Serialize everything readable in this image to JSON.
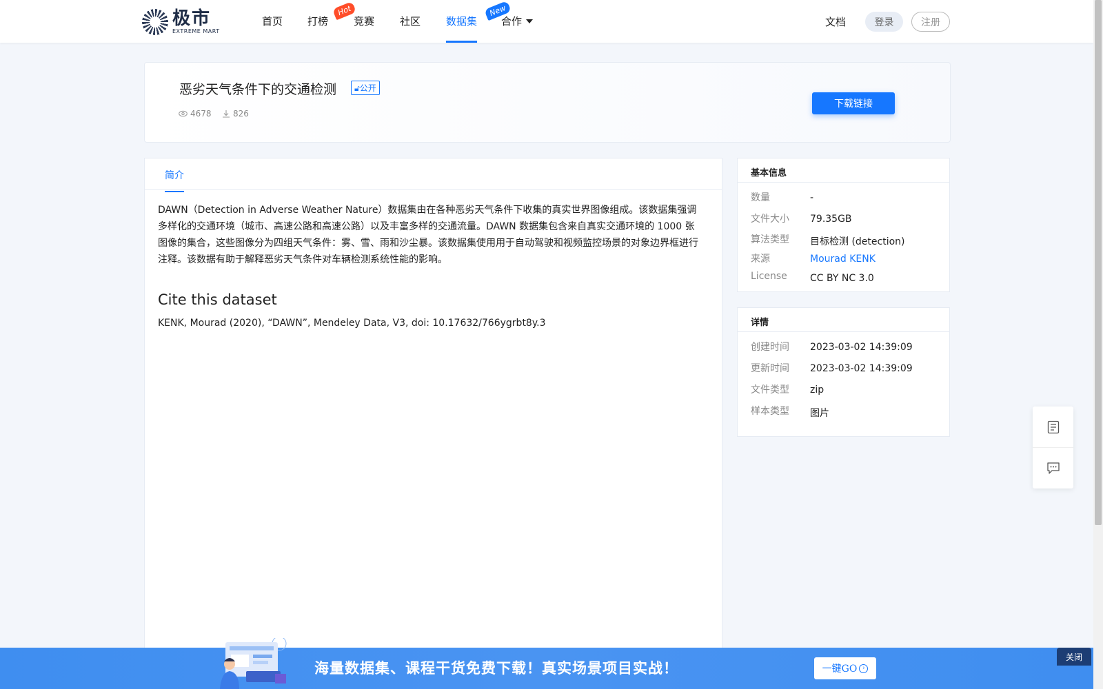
{
  "nav": {
    "logo_cn": "极市",
    "logo_en": "EXTREME MART",
    "items": [
      {
        "label": "首页"
      },
      {
        "label": "打榜",
        "badge": "Hot"
      },
      {
        "label": "竞赛"
      },
      {
        "label": "社区"
      },
      {
        "label": "数据集",
        "badge": "New",
        "active": true
      },
      {
        "label": "合作"
      }
    ],
    "docs": "文档",
    "login": "登录",
    "register": "注册"
  },
  "dataset": {
    "title": "恶劣天气条件下的交通检测",
    "visibility": "公开",
    "views": "4678",
    "downloads": "826",
    "download_button": "下载链接"
  },
  "tabs": [
    {
      "label": "简介",
      "active": true
    }
  ],
  "intro": {
    "description": "DAWN（Detection in Adverse Weather Nature）数据集由在各种恶劣天气条件下收集的真实世界图像组成。该数据集强调多样化的交通环境（城市、高速公路和高速公路）以及丰富多样的交通流量。DAWN 数据集包含来自真实交通环境的 1000 张图像的集合，这些图像分为四组天气条件：雾、雪、雨和沙尘暴。该数据集使用用于自动驾驶和视频监控场景的对象边界框进行注释。该数据有助于解释恶劣天气条件对车辆检测系统性能的影响。",
    "cite_heading": "Cite this dataset",
    "cite_text": "KENK, Mourad (2020), “DAWN”, Mendeley Data, V3, doi: 10.17632/766ygrbt8y.3"
  },
  "basic_info": {
    "heading": "基本信息",
    "rows": [
      {
        "key": "数量",
        "value": "-"
      },
      {
        "key": "文件大小",
        "value": "79.35GB"
      },
      {
        "key": "算法类型",
        "value": "目标检测 (detection)"
      },
      {
        "key": "来源",
        "value": "Mourad KENK"
      },
      {
        "key": "License",
        "value": "CC BY NC 3.0"
      }
    ]
  },
  "details": {
    "heading": "详情",
    "rows": [
      {
        "key": "创建时间",
        "value": "2023-03-02 14:39:09"
      },
      {
        "key": "更新时间",
        "value": "2023-03-02 14:39:09"
      },
      {
        "key": "文件类型",
        "value": "zip"
      },
      {
        "key": "样本类型",
        "value": "图片"
      }
    ]
  },
  "float_tools": {
    "icons": [
      "document-icon",
      "chat-icon"
    ]
  },
  "banner": {
    "text": "海量数据集、课程干货免费下载！真实场景项目实战！",
    "go_button": "一键GO",
    "close_button": "关闭"
  },
  "colors": {
    "accent": "#1677ff",
    "hot": "#ff4d29",
    "banner": "#3f8ef0"
  }
}
